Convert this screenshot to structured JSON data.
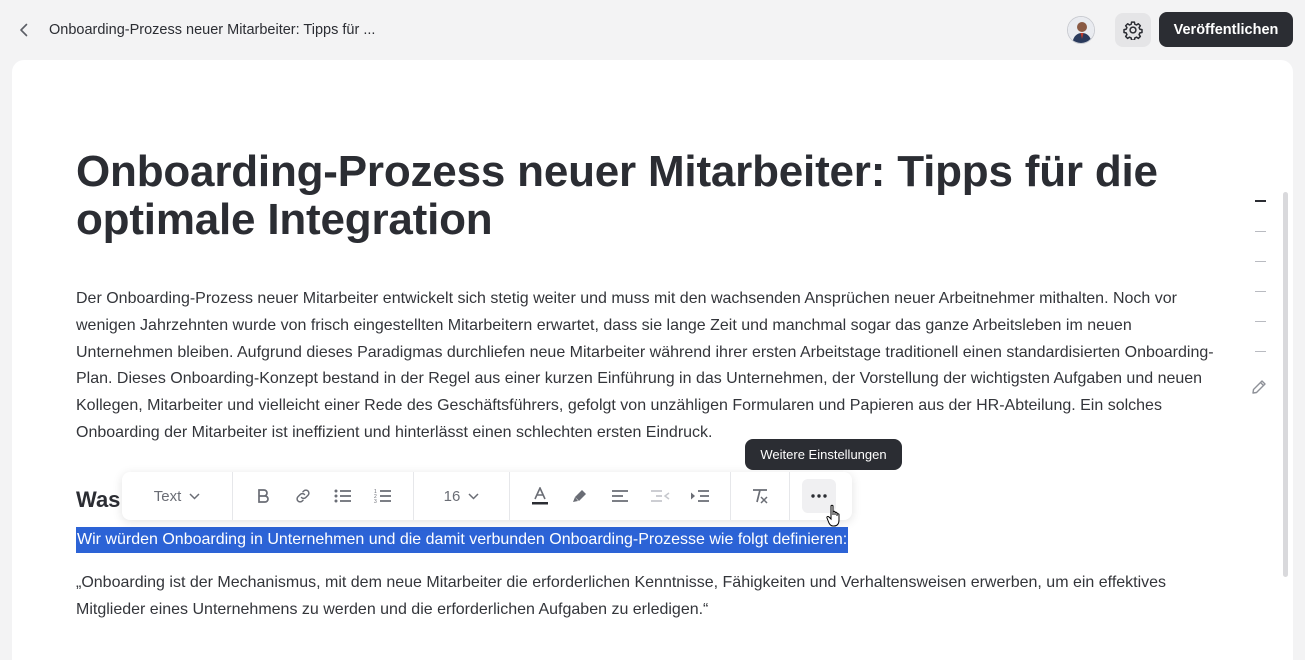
{
  "header": {
    "breadcrumb": "Onboarding-Prozess neuer Mitarbeiter: Tipps für ...",
    "publish_label": "Veröffentlichen"
  },
  "article": {
    "title": "Onboarding-Prozess neuer Mitarbeiter: Tipps für die optimale Integration",
    "intro": "Der Onboarding-Prozess neuer Mitarbeiter entwickelt sich stetig weiter und muss mit den wachsenden Ansprüchen neuer Arbeitnehmer mithalten. Noch vor wenigen Jahrzehnten wurde von frisch eingestellten Mitarbeitern erwartet, dass sie lange Zeit und manchmal sogar das ganze Arbeitsleben im neuen Unternehmen bleiben. Aufgrund dieses Paradigmas durchliefen neue Mitarbeiter während ihrer ersten Arbeitstage traditionell einen standardisierten Onboarding-Plan. Dieses Onboarding-Konzept bestand in der Regel aus einer kurzen Einführung in das Unternehmen, der Vorstellung der wichtigsten Aufgaben und neuen Kollegen, Mitarbeiter und vielleicht einer Rede des Geschäftsführers, gefolgt von unzähligen Formularen und Papieren aus der HR-Abteilung. Ein solches Onboarding der Mitarbeiter ist ineffizient und hinterlässt einen schlechten ersten Eindruck.",
    "heading_partial": "Was",
    "selected_text": "Wir würden Onboarding in Unternehmen und die damit verbunden Onboarding-Prozesse wie folgt definieren:",
    "quote": "„Onboarding ist der Mechanismus, mit dem neue Mitarbeiter die erforderlichen Kenntnisse, Fähigkeiten und Verhaltensweisen erwerben, um ein effektives Mitglieder eines Unternehmens zu werden und die erforderlichen Aufgaben zu erledigen.“"
  },
  "toolbar": {
    "block_type": "Text",
    "font_size": "16",
    "more_tooltip": "Weitere Einstellungen"
  },
  "colors": {
    "selection": "#2c63d6",
    "primary_button": "#2b2d33"
  }
}
